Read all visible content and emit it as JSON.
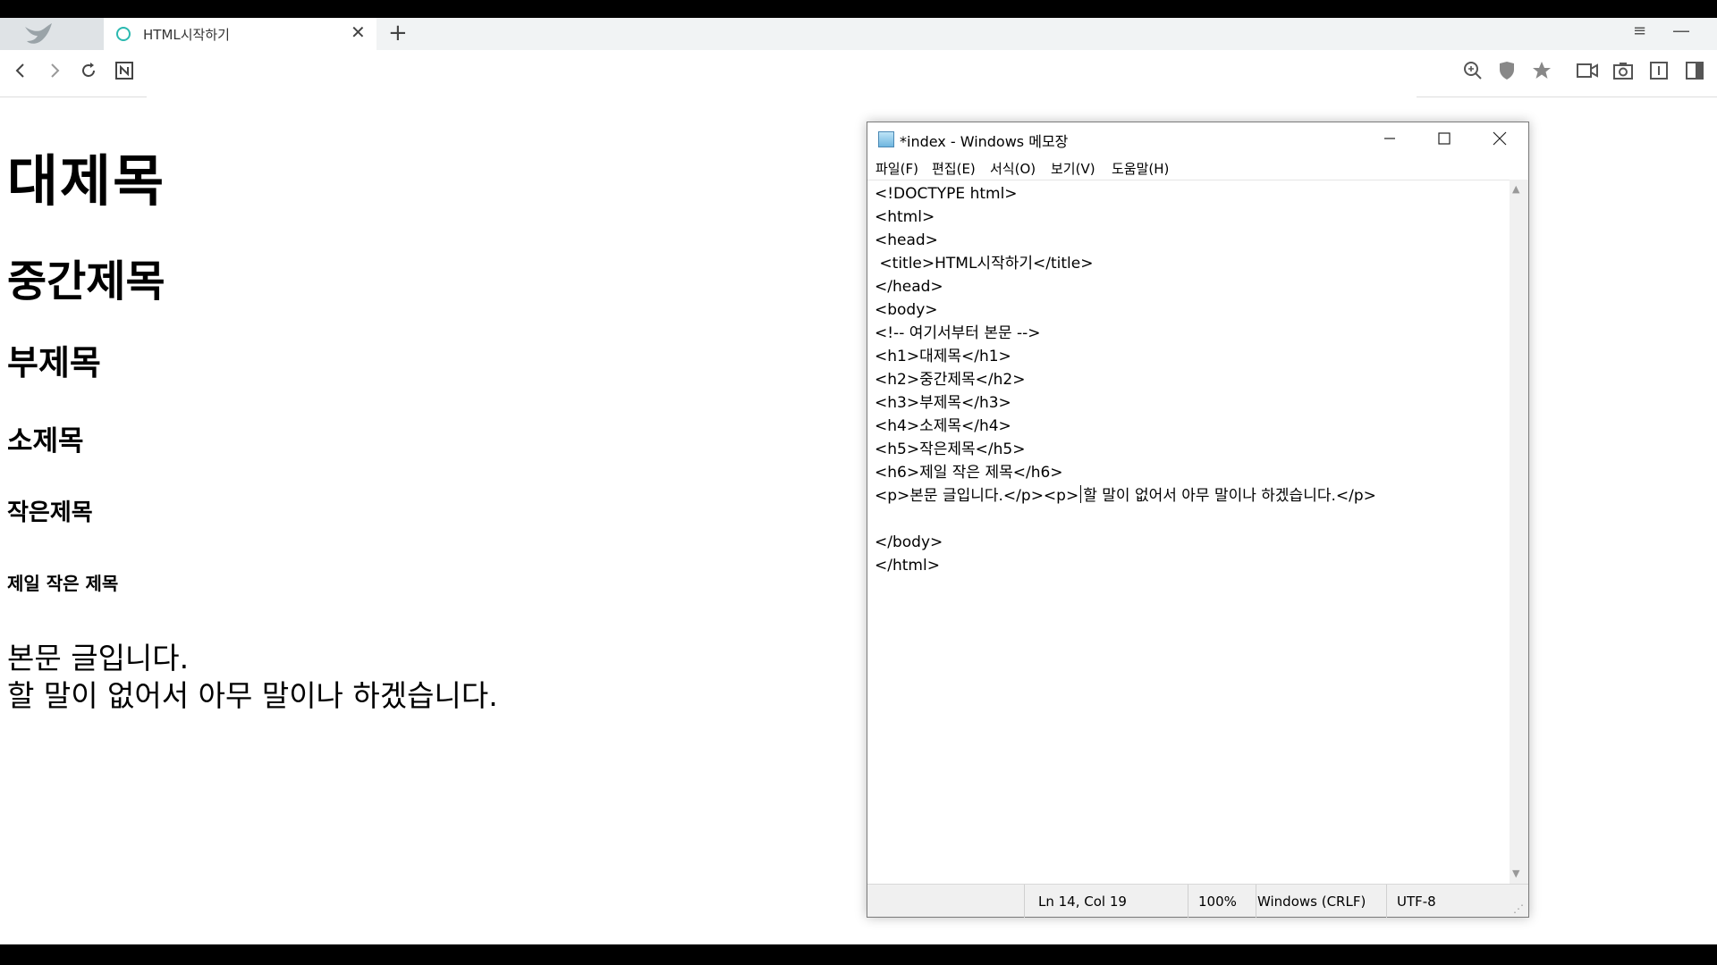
{
  "browser": {
    "tab_title": "HTML시작하기",
    "tab_close": "✕",
    "new_tab": "+",
    "strip_menu": "≡",
    "strip_min": "—"
  },
  "page": {
    "h1": "대제목",
    "h2": "중간제목",
    "h3": "부제목",
    "h4": "소제목",
    "h5": "작은제목",
    "h6": "제일 작은 제목",
    "p1": "본문 글입니다.",
    "p2": "할 말이 없어서 아무 말이나 하겠습니다."
  },
  "notepad": {
    "title": "*index - Windows 메모장",
    "menu": [
      "파일(F)",
      "편집(E)",
      "서식(O)",
      "보기(V)",
      "도움말(H)"
    ],
    "lines": [
      "<!DOCTYPE html>",
      "<html>",
      "<head>",
      " <title>HTML시작하기</title>",
      "</head>",
      "<body>",
      "<!-- 여기서부터 본문 -->",
      "<h1>대제목</h1>",
      "<h2>중간제목</h2>",
      "<h3>부제목</h3>",
      "<h4>소제목</h4>",
      "<h5>작은제목</h5>",
      "<h6>제일 작은 제목</h6>"
    ],
    "caret_line_before": "<p>본문 글입니다.</p><p>",
    "caret_line_after": "할 말이 없어서 아무 말이나 하겠습니다.</p>",
    "lines_after": [
      "",
      "</body>",
      "</html>"
    ],
    "status": {
      "position": "Ln 14, Col 19",
      "zoom": "100%",
      "line_ending": "Windows (CRLF)",
      "encoding": "UTF-8"
    }
  }
}
